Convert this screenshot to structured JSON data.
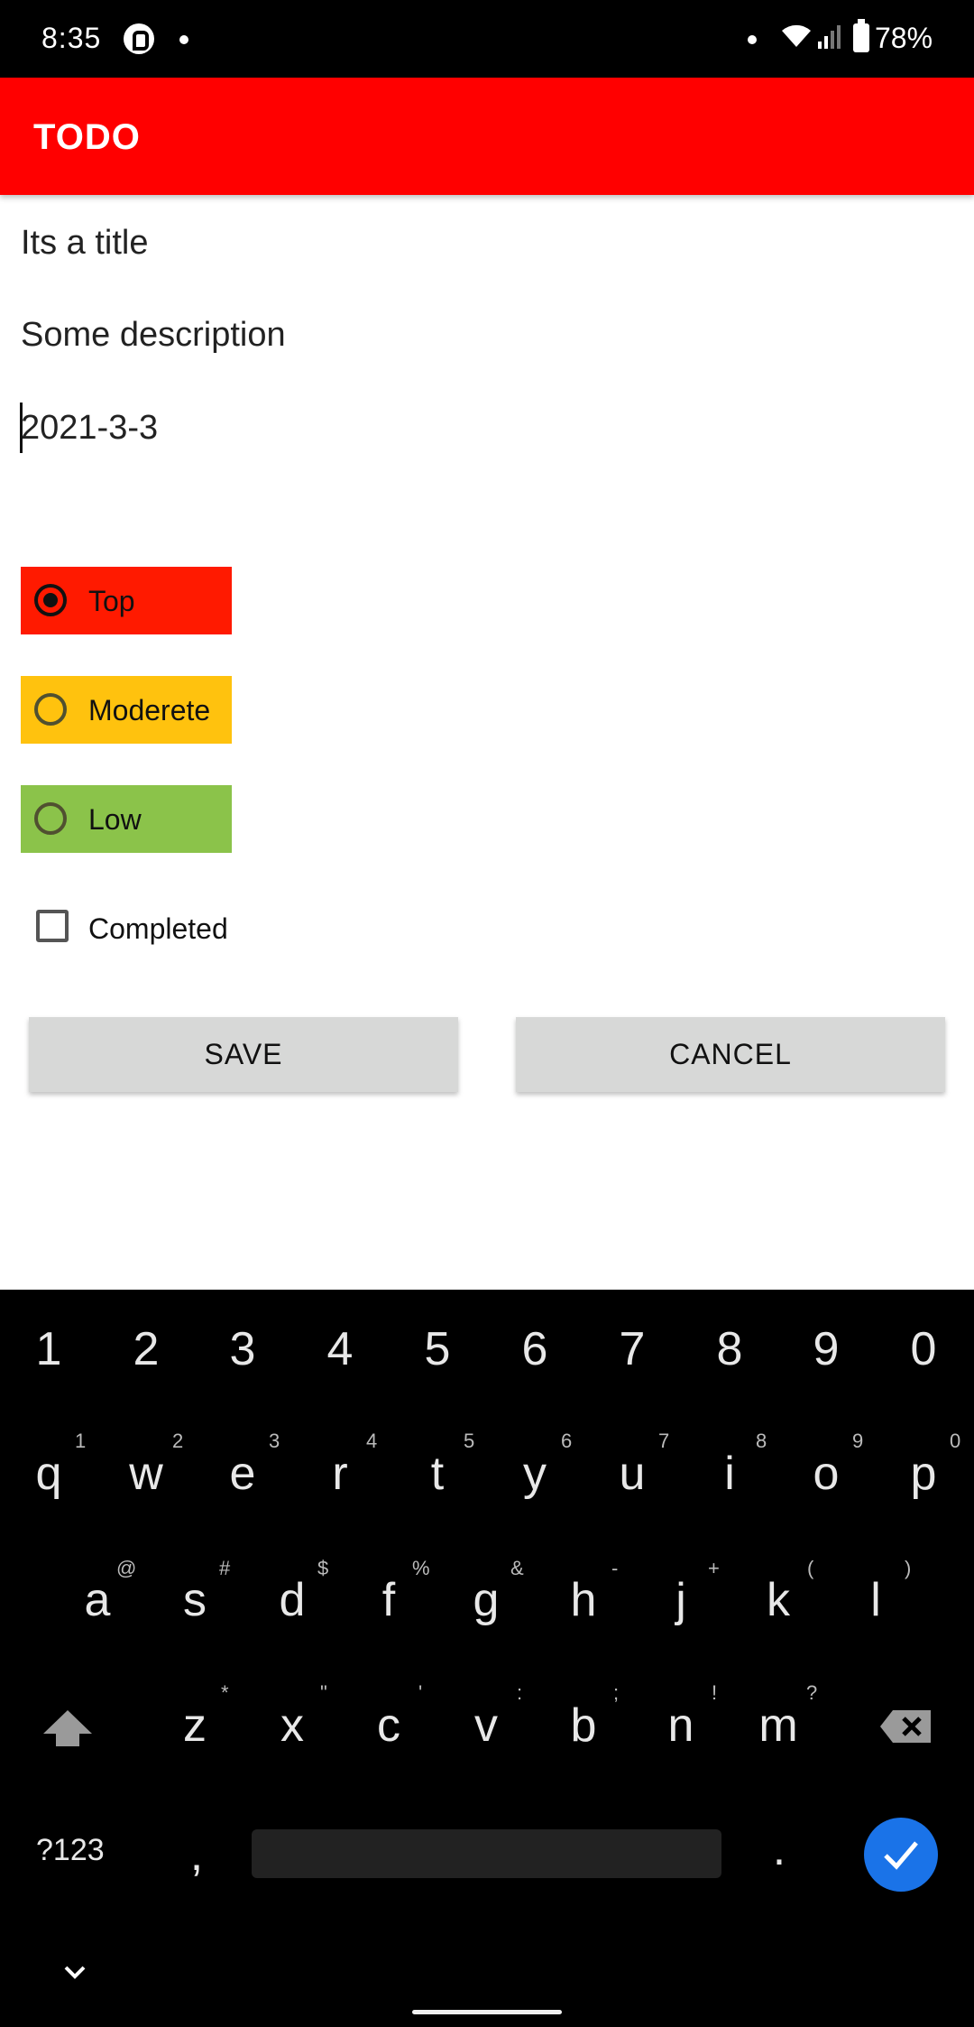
{
  "status_bar": {
    "time": "8:35",
    "battery": "78%"
  },
  "app_bar": {
    "title": "TODO"
  },
  "form": {
    "title_value": "Its a title",
    "description_value": "Some description",
    "date_value": "2021-3-3"
  },
  "priority": {
    "options": [
      {
        "label": "Top",
        "color": "#ff1a00",
        "selected": true
      },
      {
        "label": "Moderete",
        "color": "#ffc20e",
        "selected": false
      },
      {
        "label": "Low",
        "color": "#8bc34a",
        "selected": false
      }
    ]
  },
  "completed_label": "Completed",
  "buttons": {
    "save": "SAVE",
    "cancel": "CANCEL"
  },
  "keyboard": {
    "number_row": [
      "1",
      "2",
      "3",
      "4",
      "5",
      "6",
      "7",
      "8",
      "9",
      "0"
    ],
    "row1": [
      "q",
      "w",
      "e",
      "r",
      "t",
      "y",
      "u",
      "i",
      "o",
      "p"
    ],
    "row1_hints": [
      "1",
      "2",
      "3",
      "4",
      "5",
      "6",
      "7",
      "8",
      "9",
      "0"
    ],
    "row2": [
      "a",
      "s",
      "d",
      "f",
      "g",
      "h",
      "j",
      "k",
      "l"
    ],
    "row2_hints": [
      "@",
      "#",
      "$",
      "%",
      "&",
      "-",
      "+",
      "(",
      ")"
    ],
    "row3": [
      "z",
      "x",
      "c",
      "v",
      "b",
      "n",
      "m"
    ],
    "row3_hints": [
      "*",
      "\"",
      "'",
      ":",
      ";",
      "!",
      "?"
    ],
    "symbols_label": "?123",
    "comma": ",",
    "period": "."
  }
}
